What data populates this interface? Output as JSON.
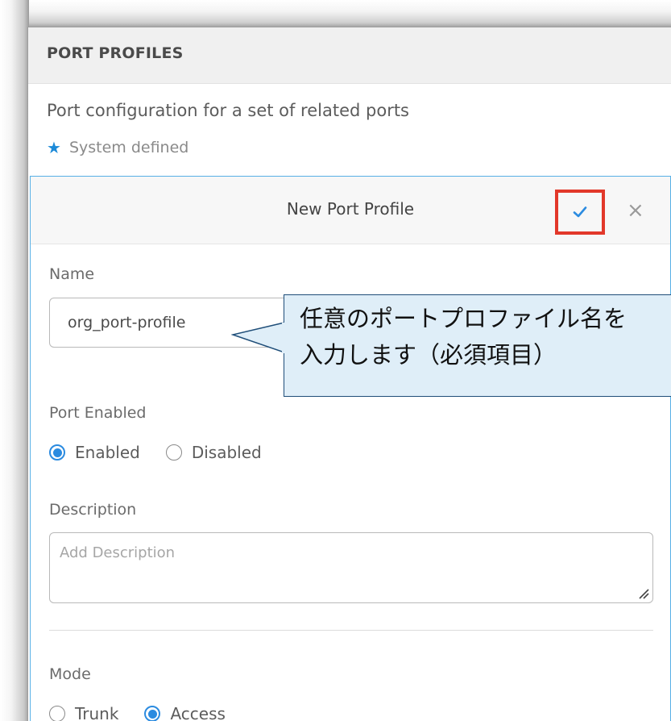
{
  "panel": {
    "title": "PORT PROFILES",
    "description": "Port configuration for a set of related ports",
    "system_defined_label": "System defined"
  },
  "card": {
    "title": "New Port Profile",
    "confirm_icon": "check-icon",
    "close_icon": "close-icon",
    "close_glyph": "×"
  },
  "form": {
    "name_label": "Name",
    "name_value": "org_port-profile",
    "port_enabled_label": "Port Enabled",
    "port_enabled_options": [
      "Enabled",
      "Disabled"
    ],
    "port_enabled_selected": "Enabled",
    "description_label": "Description",
    "description_placeholder": "Add Description",
    "mode_label": "Mode",
    "mode_options": [
      "Trunk",
      "Access"
    ],
    "mode_selected": "Access"
  },
  "callout": {
    "text": "任意のポートプロファイル名を\n入力します（必須項目）"
  },
  "colors": {
    "accent": "#2b8be0",
    "highlight_border": "#e2382a",
    "callout_fill": "#dfeef8",
    "callout_border": "#1f4e79"
  }
}
